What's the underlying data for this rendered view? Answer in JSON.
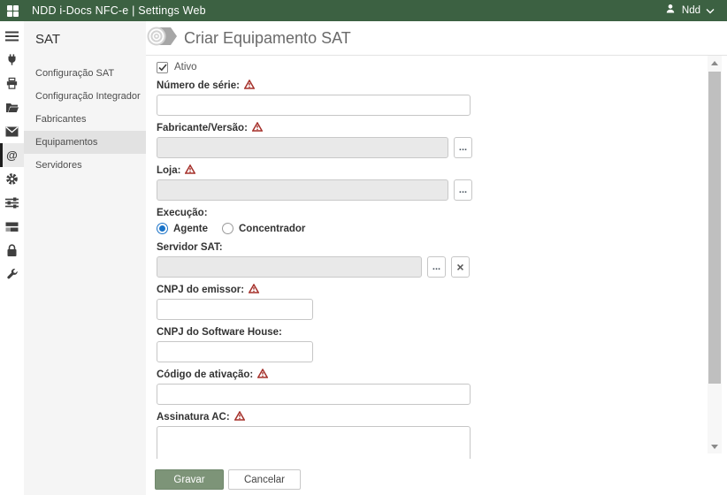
{
  "topbar": {
    "title": "NDD i-Docs NFC-e | Settings Web",
    "user_label": "Ndd"
  },
  "icons": {
    "apps": "apps-grid",
    "user": "person-silhouette",
    "user_caret": "chevron-down",
    "at_glyph": "@",
    "rail": [
      "menu",
      "plug",
      "printer",
      "folder-open",
      "mail",
      "at-sign",
      "gear",
      "sliders",
      "server-stack",
      "lock",
      "wrench"
    ],
    "required": "warning-triangle",
    "picker_glyph": "...",
    "clear_glyph": "×"
  },
  "colors": {
    "topbar_green": "#3c6142",
    "save_green": "#7d9478",
    "warning_red": "#a5302a",
    "radio_blue": "#1a73c8",
    "panel_gray": "#f5f5f5",
    "selected_gray": "#e2e2e2"
  },
  "sidebar": {
    "title": "SAT",
    "items": [
      {
        "label": "Configuração SAT",
        "selected": false
      },
      {
        "label": "Configuração Integrador",
        "selected": false
      },
      {
        "label": "Fabricantes",
        "selected": false
      },
      {
        "label": "Equipamentos",
        "selected": true
      },
      {
        "label": "Servidores",
        "selected": false
      }
    ]
  },
  "page": {
    "title": "Criar Equipamento SAT"
  },
  "form": {
    "active": {
      "label": "Ativo",
      "checked": true
    },
    "numero_serie": {
      "label": "Número de série:",
      "required": true,
      "value": "",
      "placeholder": ""
    },
    "fabricante_versao": {
      "label": "Fabricante/Versão:",
      "required": true,
      "value": "",
      "disabled": true
    },
    "loja": {
      "label": "Loja:",
      "required": true,
      "value": "",
      "disabled": true
    },
    "execucao": {
      "label": "Execução:",
      "options": [
        "Agente",
        "Concentrador"
      ],
      "selected": "Agente"
    },
    "servidor_sat": {
      "label": "Servidor SAT:",
      "required": false,
      "value": "",
      "disabled": true
    },
    "cnpj_emissor": {
      "label": "CNPJ do emissor:",
      "required": true,
      "value": "",
      "placeholder": ""
    },
    "cnpj_software_house": {
      "label": "CNPJ do Software House:",
      "required": false,
      "value": "",
      "placeholder": ""
    },
    "codigo_ativacao": {
      "label": "Código de ativação:",
      "required": true,
      "value": "",
      "placeholder": ""
    },
    "assinatura_ac": {
      "label": "Assinatura AC:",
      "required": true,
      "value": ""
    }
  },
  "footer": {
    "save_label": "Gravar",
    "cancel_label": "Cancelar"
  }
}
